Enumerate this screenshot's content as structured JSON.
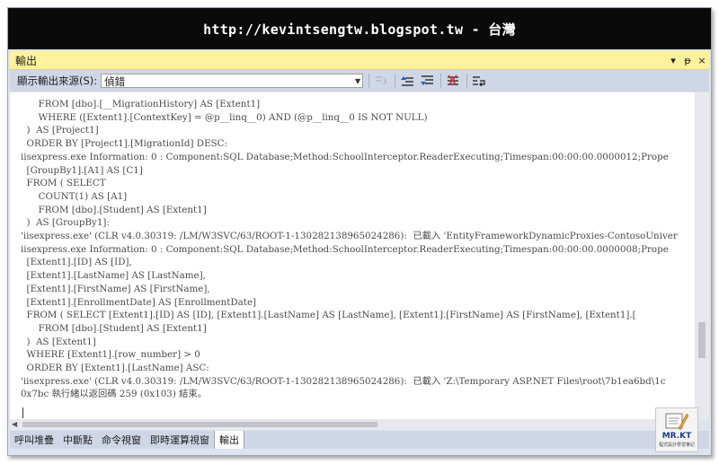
{
  "banner": {
    "text": "http://kevintsengtw.blogspot.tw - 台灣"
  },
  "window": {
    "title": "輸出",
    "buttons": {
      "dropdown": "▾",
      "pin": "ᵽ",
      "close": "×"
    }
  },
  "toolbar": {
    "source_label": "顯示輸出來源(S):",
    "source_value": "偵錯"
  },
  "output": {
    "lines": [
      "      FROM [dbo].[__MigrationHistory] AS [Extent1]",
      "      WHERE ([Extent1].[ContextKey] = @p__linq__0) AND (@p__linq__0 IS NOT NULL)",
      "  )  AS [Project1]",
      "  ORDER BY [Project1].[MigrationId] DESC:",
      "iisexpress.exe Information: 0 : Component:SQL Database;Method:SchoolInterceptor.ReaderExecuting;Timespan:00:00:00.0000012;Prope",
      "  [GroupBy1].[A1] AS [C1]",
      "  FROM ( SELECT",
      "      COUNT(1) AS [A1]",
      "      FROM [dbo].[Student] AS [Extent1]",
      "  )  AS [GroupBy1]:",
      "'iisexpress.exe' (CLR v4.0.30319: /LM/W3SVC/63/ROOT-1-130282138965024286):  已載入 'EntityFrameworkDynamicProxies-ContosoUniver",
      "iisexpress.exe Information: 0 : Component:SQL Database;Method:SchoolInterceptor.ReaderExecuting;Timespan:00:00:00.0000008;Prope",
      "  [Extent1].[ID] AS [ID],",
      "  [Extent1].[LastName] AS [LastName],",
      "  [Extent1].[FirstName] AS [FirstName],",
      "  [Extent1].[EnrollmentDate] AS [EnrollmentDate]",
      "  FROM ( SELECT [Extent1].[ID] AS [ID], [Extent1].[LastName] AS [LastName], [Extent1].[FirstName] AS [FirstName], [Extent1].[",
      "      FROM [dbo].[Student] AS [Extent1]",
      "  )  AS [Extent1]",
      "  WHERE [Extent1].[row_number] > 0",
      "  ORDER BY [Extent1].[LastName] ASC:",
      "'iisexpress.exe' (CLR v4.0.30319: /LM/W3SVC/63/ROOT-1-130282138965024286):  已載入 'Z:\\Temporary ASP.NET Files\\root\\7b1ea6bd\\1c",
      "0x7bc 執行緒以返回碼 259 (0x103) 結束。"
    ]
  },
  "tabs": [
    {
      "label": "呼叫堆疊"
    },
    {
      "label": "中斷點"
    },
    {
      "label": "命令視窗"
    },
    {
      "label": "即時運算視窗"
    },
    {
      "label": "輸出"
    }
  ],
  "logo": {
    "text": "MR.KT",
    "subtext": "程式設計學習筆記"
  },
  "colors": {
    "titlebar": "#fff29d",
    "toolbar": "#cfd6e5",
    "banner": "#0a0a0a",
    "output_text": "#4a4a4a"
  }
}
